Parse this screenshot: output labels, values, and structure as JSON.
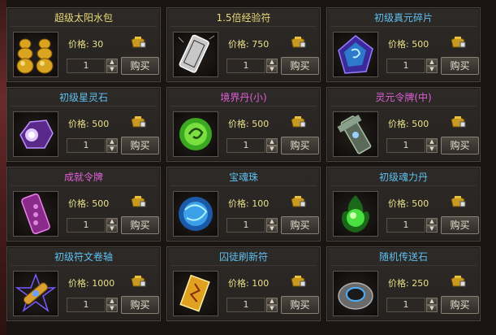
{
  "colors": {
    "title_gold": "#e8d878",
    "title_cyan": "#5ec0f0",
    "title_pink": "#e060d8",
    "price_yellow": "#e8e08a"
  },
  "items": [
    {
      "name": "超级太阳水包",
      "price_label": "价格: 30",
      "qty": "1",
      "buy_label": "购买",
      "icon": "sun-water-pack-icon",
      "title_color": "#e8d878"
    },
    {
      "name": "1.5倍经验符",
      "price_label": "价格: 750",
      "qty": "1",
      "buy_label": "购买",
      "icon": "exp-talisman-icon",
      "title_color": "#e8d878"
    },
    {
      "name": "初级真元碎片",
      "price_label": "价格: 500",
      "qty": "1",
      "buy_label": "购买",
      "icon": "true-yuan-shard-icon",
      "title_color": "#5ec0f0"
    },
    {
      "name": "初级星灵石",
      "price_label": "价格: 500",
      "qty": "1",
      "buy_label": "购买",
      "icon": "star-spirit-stone-icon",
      "title_color": "#5ec0f0"
    },
    {
      "name": "境界丹(小)",
      "price_label": "价格: 500",
      "qty": "1",
      "buy_label": "购买",
      "icon": "realm-pill-icon",
      "title_color": "#e060d8"
    },
    {
      "name": "灵元令牌(中)",
      "price_label": "价格: 500",
      "qty": "1",
      "buy_label": "购买",
      "icon": "spirit-token-icon",
      "title_color": "#e060d8"
    },
    {
      "name": "成就令牌",
      "price_label": "价格: 500",
      "qty": "1",
      "buy_label": "购买",
      "icon": "achievement-token-icon",
      "title_color": "#e060d8"
    },
    {
      "name": "宝魂珠",
      "price_label": "价格: 100",
      "qty": "1",
      "buy_label": "购买",
      "icon": "treasure-soul-orb-icon",
      "title_color": "#5ec0f0"
    },
    {
      "name": "初级魂力丹",
      "price_label": "价格: 500",
      "qty": "1",
      "buy_label": "购买",
      "icon": "soul-power-pill-icon",
      "title_color": "#5ec0f0"
    },
    {
      "name": "初级符文卷轴",
      "price_label": "价格: 1000",
      "qty": "1",
      "buy_label": "购买",
      "icon": "rune-scroll-icon",
      "title_color": "#5ec0f0"
    },
    {
      "name": "囚徒刷新符",
      "price_label": "价格: 100",
      "qty": "1",
      "buy_label": "购买",
      "icon": "prisoner-refresh-talisman-icon",
      "title_color": "#5ec0f0"
    },
    {
      "name": "随机传送石",
      "price_label": "价格: 250",
      "qty": "1",
      "buy_label": "购买",
      "icon": "random-teleport-stone-icon",
      "title_color": "#5ec0f0"
    }
  ]
}
